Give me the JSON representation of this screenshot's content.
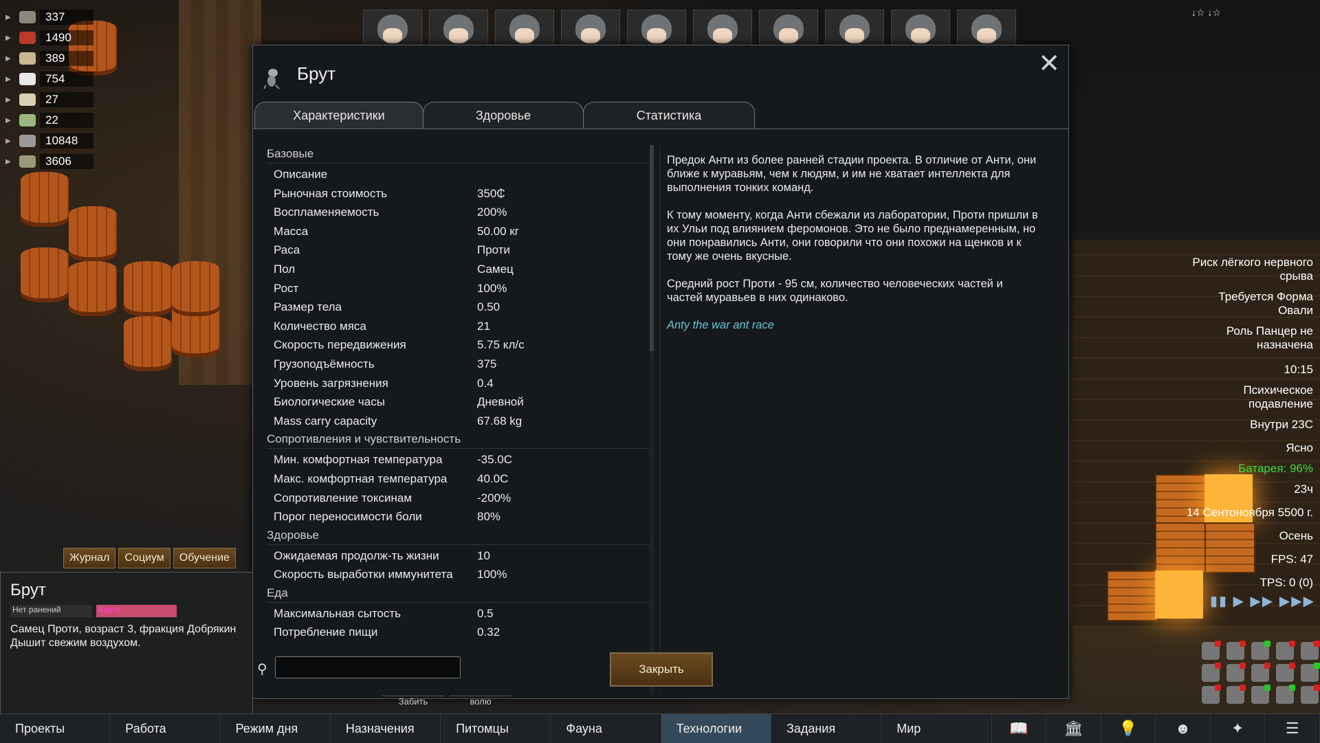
{
  "resources": [
    {
      "value": "337",
      "color": "#8a8a7a"
    },
    {
      "value": "1490",
      "color": "#b83a2a"
    },
    {
      "value": "389",
      "color": "#c8b890"
    },
    {
      "value": "754",
      "color": "#e8e8e8"
    },
    {
      "value": "27",
      "color": "#d8d0b0"
    },
    {
      "value": "22",
      "color": "#9ab880"
    },
    {
      "value": "10848",
      "color": "#9a9a9a"
    },
    {
      "value": "3606",
      "color": "#9a9a7a"
    }
  ],
  "topright_icons": "↓☆ ↓☆",
  "dialog": {
    "title": "Брут",
    "close_glyph": "✕",
    "tabs": [
      "Характеристики",
      "Здоровье",
      "Статистика"
    ],
    "sections": [
      {
        "title": "Базовые",
        "rows": [
          {
            "label": "Описание",
            "value": ""
          },
          {
            "label": "Рыночная стоимость",
            "value": "350₵"
          },
          {
            "label": "Воспламеняемость",
            "value": "200%"
          },
          {
            "label": "Масса",
            "value": "50.00 кг"
          },
          {
            "label": "Раса",
            "value": "Проти"
          },
          {
            "label": "Пол",
            "value": "Самец"
          },
          {
            "label": "Рост",
            "value": "100%"
          },
          {
            "label": "Размер тела",
            "value": "0.50"
          },
          {
            "label": "Количество мяса",
            "value": "21"
          },
          {
            "label": "Скорость передвижения",
            "value": "5.75 кл/с"
          },
          {
            "label": "Грузоподъёмность",
            "value": "375"
          },
          {
            "label": "Уровень загрязнения",
            "value": "0.4"
          },
          {
            "label": "Биологические часы",
            "value": "Дневной"
          },
          {
            "label": "Mass carry capacity",
            "value": "67.68 kg"
          }
        ]
      },
      {
        "title": "Сопротивления и чувствительность",
        "rows": [
          {
            "label": "Мин. комфортная температура",
            "value": "-35.0C"
          },
          {
            "label": "Макс. комфортная температура",
            "value": "40.0C"
          },
          {
            "label": "Сопротивление токсинам",
            "value": "-200%"
          },
          {
            "label": "Порог переносимости боли",
            "value": "80%"
          }
        ]
      },
      {
        "title": "Здоровье",
        "rows": [
          {
            "label": "Ожидаемая продолж-ть жизни",
            "value": "10"
          },
          {
            "label": "Скорость выработки иммунитета",
            "value": "100%"
          }
        ]
      },
      {
        "title": "Еда",
        "rows": [
          {
            "label": "Максимальная сытость",
            "value": "0.5"
          },
          {
            "label": "Потребление пищи",
            "value": "0.32"
          }
        ]
      }
    ],
    "description": [
      "Предок Анти из более ранней стадии проекта. В отличие от Анти, они ближе к муравьям, чем к людям, и им не хватает интеллекта для выполнения тонких команд.",
      "К тому моменту, когда Анти сбежали из лаборатории, Проти пришли в их Ульи под влиянием феромонов. Это не было преднамеренным, но они понравились Анти, они говорили что они похожи на щенков и к тому же очень вкусные.",
      "Средний рост Проти - 95 см, количество человеческих частей и частей муравьев в них одинаково."
    ],
    "mod_link": "Anty the war ant race",
    "search_placeholder": "",
    "close_button": "Закрыть"
  },
  "alerts": {
    "a1": "Риск лёгкого нервного срыва",
    "a2": "Требуется Форма Овали",
    "a3": "Роль Панцер не назначена",
    "time": "10:15",
    "psychic": "Психическое подавление",
    "temp": "Внутри 23C",
    "weather": "Ясно",
    "battery": "Батарея: 96%",
    "hours": "23ч",
    "date": "14 Сентоноября 5500 г.",
    "season": "Осень",
    "fps": "FPS: 47",
    "tps": "TPS: 0 (0)"
  },
  "speed_controls": "▮▮ ▶ ▶▶ ▶▶▶",
  "colonist": {
    "tabs": [
      "Журнал",
      "Социум",
      "Обучение"
    ],
    "name": "Брут",
    "badge1": "Нет ранений",
    "badge2": "Карта",
    "line1": "Самец Проти, возраст 3, фракция Добрякин",
    "line2": "Дышит свежим воздухом."
  },
  "under_buttons": [
    "Забить",
    "волю"
  ],
  "bottom_tabs": [
    "Проекты",
    "Работа",
    "Режим дня",
    "Назначения",
    "Питомцы",
    "Фауна",
    "Технологии",
    "Задания",
    "Мир"
  ],
  "bottom_icons": [
    "📖",
    "🏛",
    "💡",
    "☻",
    "✦",
    "☰"
  ],
  "accent_color": "#344a5a"
}
